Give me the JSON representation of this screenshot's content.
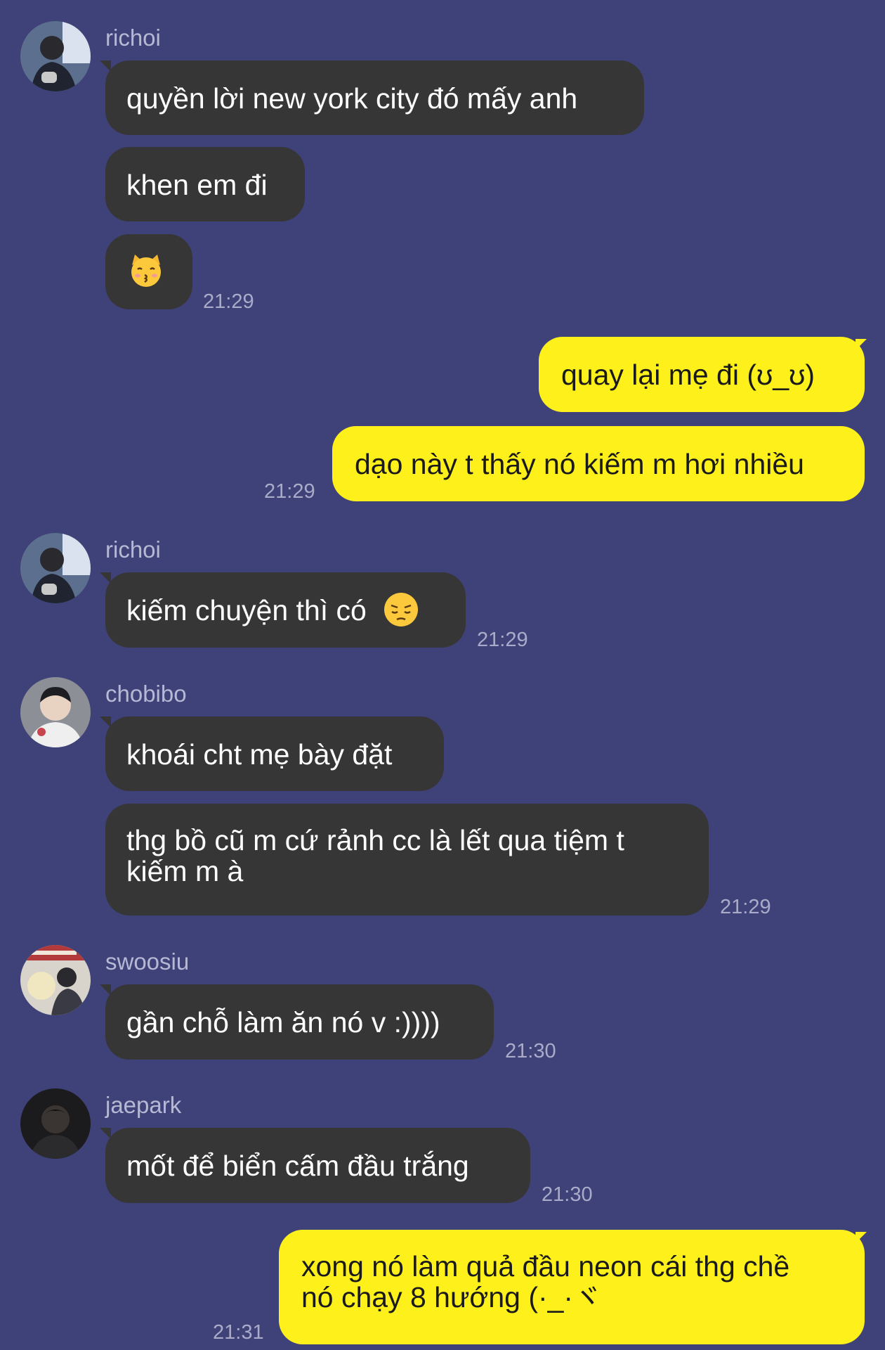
{
  "messages": {
    "m1": {
      "sender": "richoi",
      "avatar_icon": "user-photo-avatar",
      "text": "quyền lời new york city đó mấy anh"
    },
    "m2": {
      "text": "khen em đi"
    },
    "m3": {
      "emoji": "kissing-cat-emoji",
      "time": "21:29"
    },
    "m4": {
      "text": "quay lại mẹ đi (ʊ_ʊ)"
    },
    "m5": {
      "text": "dạo này t thấy nó kiếm m hơi nhiều",
      "time": "21:29"
    },
    "m6": {
      "sender": "richoi",
      "avatar_icon": "user-photo-avatar",
      "text": "kiếm chuyện thì có",
      "emoji": "pensive-face-emoji",
      "time": "21:29"
    },
    "m7": {
      "sender": "chobibo",
      "avatar_icon": "user-photo-avatar",
      "text": "khoái cht mẹ bày đặt"
    },
    "m8": {
      "text_line1": "thg bồ cũ m cứ rảnh cc là lết qua tiệm t",
      "text_line2": "kiếm m à",
      "time": "21:29"
    },
    "m9": {
      "sender": "swoosiu",
      "avatar_icon": "user-photo-avatar",
      "text": "gần chỗ làm ăn nó v :))))",
      "time": "21:30"
    },
    "m10": {
      "sender": "jaepark",
      "avatar_icon": "user-photo-avatar",
      "text": "mốt để biển cấm đầu trắng",
      "time": "21:30"
    },
    "m11": {
      "text_line1": "xong nó làm quả đầu neon cái thg chề",
      "text_line2": "nó chạy 8 hướng (·_·ヾ",
      "time": "21:31"
    }
  },
  "colors": {
    "background": "#3f4278",
    "incoming_bubble": "#363636",
    "outgoing_bubble": "#fef01b"
  }
}
